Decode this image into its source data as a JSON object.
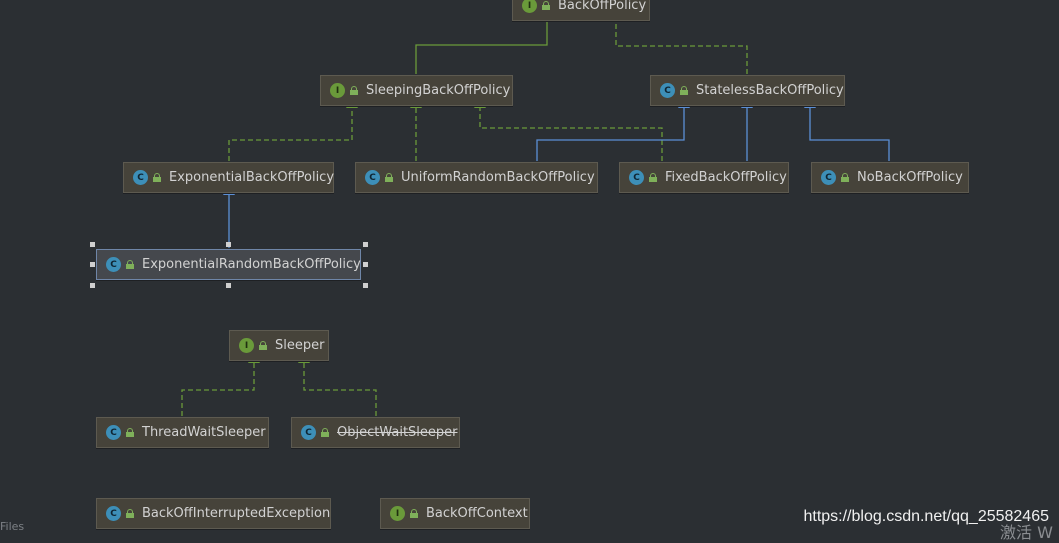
{
  "diagram": {
    "nodes": [
      {
        "id": "backoffpolicy",
        "kind": "I",
        "label": "BackOffPolicy"
      },
      {
        "id": "sleeping",
        "kind": "I",
        "label": "SleepingBackOffPolicy"
      },
      {
        "id": "stateless",
        "kind": "C",
        "label": "StatelessBackOffPolicy"
      },
      {
        "id": "exponential",
        "kind": "C",
        "label": "ExponentialBackOffPolicy"
      },
      {
        "id": "uniform",
        "kind": "C",
        "label": "UniformRandomBackOffPolicy"
      },
      {
        "id": "fixed",
        "kind": "C",
        "label": "FixedBackOffPolicy"
      },
      {
        "id": "noback",
        "kind": "C",
        "label": "NoBackOffPolicy"
      },
      {
        "id": "exprandom",
        "kind": "C",
        "label": "ExponentialRandomBackOffPolicy"
      },
      {
        "id": "sleeper",
        "kind": "I",
        "label": "Sleeper"
      },
      {
        "id": "threadwait",
        "kind": "C",
        "label": "ThreadWaitSleeper"
      },
      {
        "id": "objectwait",
        "kind": "C",
        "label": "ObjectWaitSleeper"
      },
      {
        "id": "interrupted",
        "kind": "C",
        "label": "BackOffInterruptedException"
      },
      {
        "id": "context",
        "kind": "I",
        "label": "BackOffContext"
      }
    ],
    "edges": [
      {
        "from": "sleeping",
        "to": "backoffpolicy",
        "type": "extends"
      },
      {
        "from": "stateless",
        "to": "backoffpolicy",
        "type": "implements"
      },
      {
        "from": "exponential",
        "to": "sleeping",
        "type": "implements"
      },
      {
        "from": "uniform",
        "to": "sleeping",
        "type": "implements"
      },
      {
        "from": "fixed",
        "to": "sleeping",
        "type": "implements"
      },
      {
        "from": "uniform",
        "to": "stateless",
        "type": "class-extends"
      },
      {
        "from": "fixed",
        "to": "stateless",
        "type": "class-extends"
      },
      {
        "from": "noback",
        "to": "stateless",
        "type": "class-extends"
      },
      {
        "from": "exprandom",
        "to": "exponential",
        "type": "class-extends"
      },
      {
        "from": "threadwait",
        "to": "sleeper",
        "type": "implements"
      },
      {
        "from": "objectwait",
        "to": "sleeper",
        "type": "implements"
      }
    ],
    "selected": "exprandom",
    "deprecated": [
      "objectwait"
    ],
    "colors": {
      "extends": "#6a9a3a",
      "class-extends": "#5b8fd6",
      "background": "#2b2f33"
    }
  },
  "footer": {
    "watermark": "https://blog.csdn.net/qq_25582465",
    "files_label": "Files",
    "activate_text": "激活 W"
  }
}
